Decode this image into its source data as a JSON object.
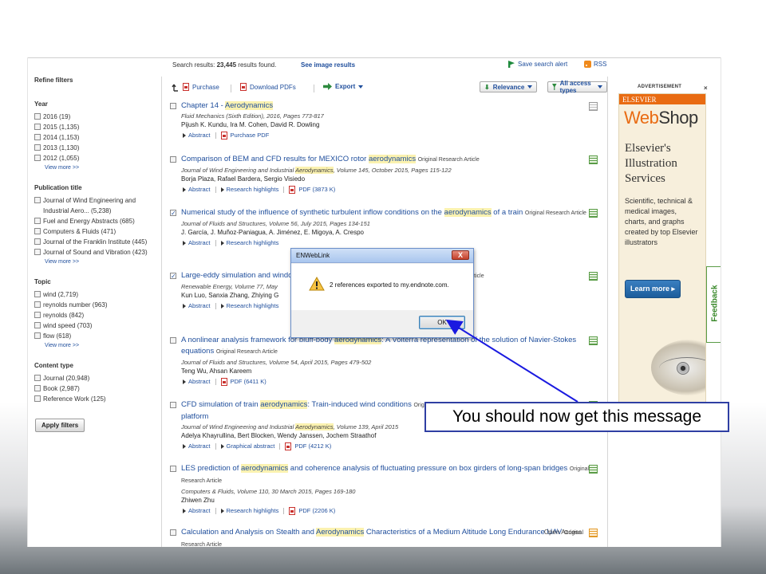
{
  "topbar": {
    "results_label": "Search results:",
    "results_count": "23,445",
    "results_suffix": "results found.",
    "image_results": "See image results",
    "save_alert": "Save search alert",
    "rss": "RSS"
  },
  "sidebar": {
    "refine": "Refine filters",
    "facets": [
      {
        "title": "Year",
        "options": [
          "2016 (19)",
          "2015 (1,135)",
          "2014 (1,153)",
          "2013 (1,130)",
          "2012 (1,055)"
        ],
        "more": "View more >>"
      },
      {
        "title": "Publication title",
        "options": [
          "Journal of Wind Engineering and Industrial Aero... (5,238)",
          "Fuel and Energy Abstracts (685)",
          "Computers & Fluids (471)",
          "Journal of the Franklin Institute (445)",
          "Journal of Sound and Vibration (423)"
        ],
        "more": "View more >>"
      },
      {
        "title": "Topic",
        "options": [
          "wind (2,719)",
          "reynolds number (963)",
          "reynolds (842)",
          "wind speed (703)",
          "flow (618)"
        ],
        "more": "View more >>"
      },
      {
        "title": "Content type",
        "options": [
          "Journal (20,948)",
          "Book (2,987)",
          "Reference Work (125)"
        ],
        "more": ""
      }
    ],
    "apply": "Apply filters"
  },
  "toolbar": {
    "purchase": "Purchase",
    "download": "Download PDFs",
    "export": "Export",
    "relevance": "Relevance",
    "access": "All access types"
  },
  "results": [
    {
      "checked": false,
      "title_pre": "Chapter 14 - ",
      "title_hl": "Aerodynamics",
      "title_post": "",
      "type": "",
      "meta_pre": "Fluid Mechanics (Sixth Edition), 2016, Pages 773-817",
      "meta_hl": "",
      "meta_post": "",
      "authors": "Pijush K. Kundu, Ira M. Cohen, David R. Dowling",
      "links": [
        "Abstract",
        "Purchase PDF"
      ],
      "icon": "plain"
    },
    {
      "checked": false,
      "title_pre": "Comparison of BEM and CFD results for MEXICO rotor ",
      "title_hl": "aerodynamics",
      "title_post": "",
      "type": "Original Research Article",
      "meta_pre": "Journal of Wind Engineering and Industrial ",
      "meta_hl": "Aerodynamics",
      "meta_post": ", Volume 145, October 2015, Pages 115-122",
      "authors": "Borja Plaza, Rafael Bardera, Sergio Visiedo",
      "links": [
        "Abstract",
        "Research highlights",
        "PDF (3873 K)"
      ],
      "icon": "green"
    },
    {
      "checked": true,
      "title_pre": "Numerical study of the influence of synthetic turbulent inflow conditions on the ",
      "title_hl": "aerodynamics",
      "title_post": " of a train",
      "type": "Original Research Article",
      "meta_pre": "Journal of Fluids and Structures, Volume 56, July 2015, Pages 134-151",
      "meta_hl": "",
      "meta_post": "",
      "authors": "J. García, J. Muñoz-Paniagua, A. Jiménez, E. Migoya, A. Crespo",
      "links": [
        "Abstract",
        "Research highlights"
      ],
      "icon": "green"
    },
    {
      "checked": true,
      "title_pre": "Large-eddy simulation and wind",
      "title_hl": "",
      "title_post": "oustics of a horizontal-axis wind turbine",
      "type": "Original Research Article",
      "meta_pre": "Renewable Energy, Volume 77, May",
      "meta_hl": "",
      "meta_post": "",
      "authors_pre": "Kun Luo, Sanxia Zhang, Zhiying G",
      "authors_post": "n, Kefa Cen",
      "links": [
        "Abstract",
        "Research highlights"
      ],
      "icon": "green"
    },
    {
      "checked": false,
      "title_pre": "A nonlinear analysis framework for bluff-body ",
      "title_hl": "aerodynamics",
      "title_post": ": A Volterra representation of the solution of Navier-Stokes equations",
      "type": "Original Research Article",
      "meta_pre": "Journal of Fluids and Structures, Volume 54, April 2015, Pages 479-502",
      "meta_hl": "",
      "meta_post": "",
      "authors": "Teng Wu, Ahsan Kareem",
      "links": [
        "Abstract",
        "PDF (6411 K)"
      ],
      "icon": "green"
    },
    {
      "checked": false,
      "title_pre": "CFD simulation of train ",
      "title_hl": "aerodynamics",
      "title_post": ": Train-induced wind conditions",
      "type": "Original Research Article",
      "title_line2": "platform",
      "meta_pre": "Journal of Wind Engineering and Industrial ",
      "meta_hl": "Aerodynamics",
      "meta_post": ", Volume 139, April 2015",
      "authors": "Adelya Khayrullina, Bert Blocken, Wendy Janssen, Jochem Straathof",
      "links": [
        "Abstract",
        "Graphical abstract",
        "PDF (4212 K)"
      ],
      "icon": "green"
    },
    {
      "checked": false,
      "title_pre": "LES prediction of ",
      "title_hl": "aerodynamics",
      "title_post": " and coherence analysis of fluctuating pressure on box girders of long-span bridges",
      "type": "Original Research Article",
      "meta_pre": "Computers & Fluids, Volume 110, 30 March 2015, Pages 169-180",
      "meta_hl": "",
      "meta_post": "",
      "authors": "Zhiwen Zhu",
      "links": [
        "Abstract",
        "Research highlights",
        "PDF (2206 K)"
      ],
      "icon": "green"
    },
    {
      "checked": false,
      "title_pre": "Calculation and Analysis on Stealth and ",
      "title_hl": "Aerodynamics",
      "title_post": " Characteristics of a Medium Altitude Long Endurance UAV",
      "type": "Original Research Article",
      "open_access": "Open Access",
      "icon": "orange"
    }
  ],
  "ad": {
    "label": "ADVERTISEMENT",
    "close": "×",
    "brand": "ELSEVIER",
    "webshop_a": "Web",
    "webshop_b": "Shop",
    "service_lines": [
      "Elsevier's",
      "Illustration",
      "Services"
    ],
    "desc": "Scientific, technical & medical images, charts, and graphs created by top Elsevier illustrators",
    "cta": "Learn more ▸"
  },
  "feedback": "Feedback",
  "dialog": {
    "title": "ENWebLink",
    "close": "X",
    "message": "2 references exported to my.endnote.com.",
    "ok": "OK"
  },
  "callout": "You should now get this message",
  "colors": {
    "link": "#1f4e9c",
    "highlight": "#fbf2b0",
    "accent_orange": "#e96b12",
    "callout_border": "#2f3fa3"
  }
}
